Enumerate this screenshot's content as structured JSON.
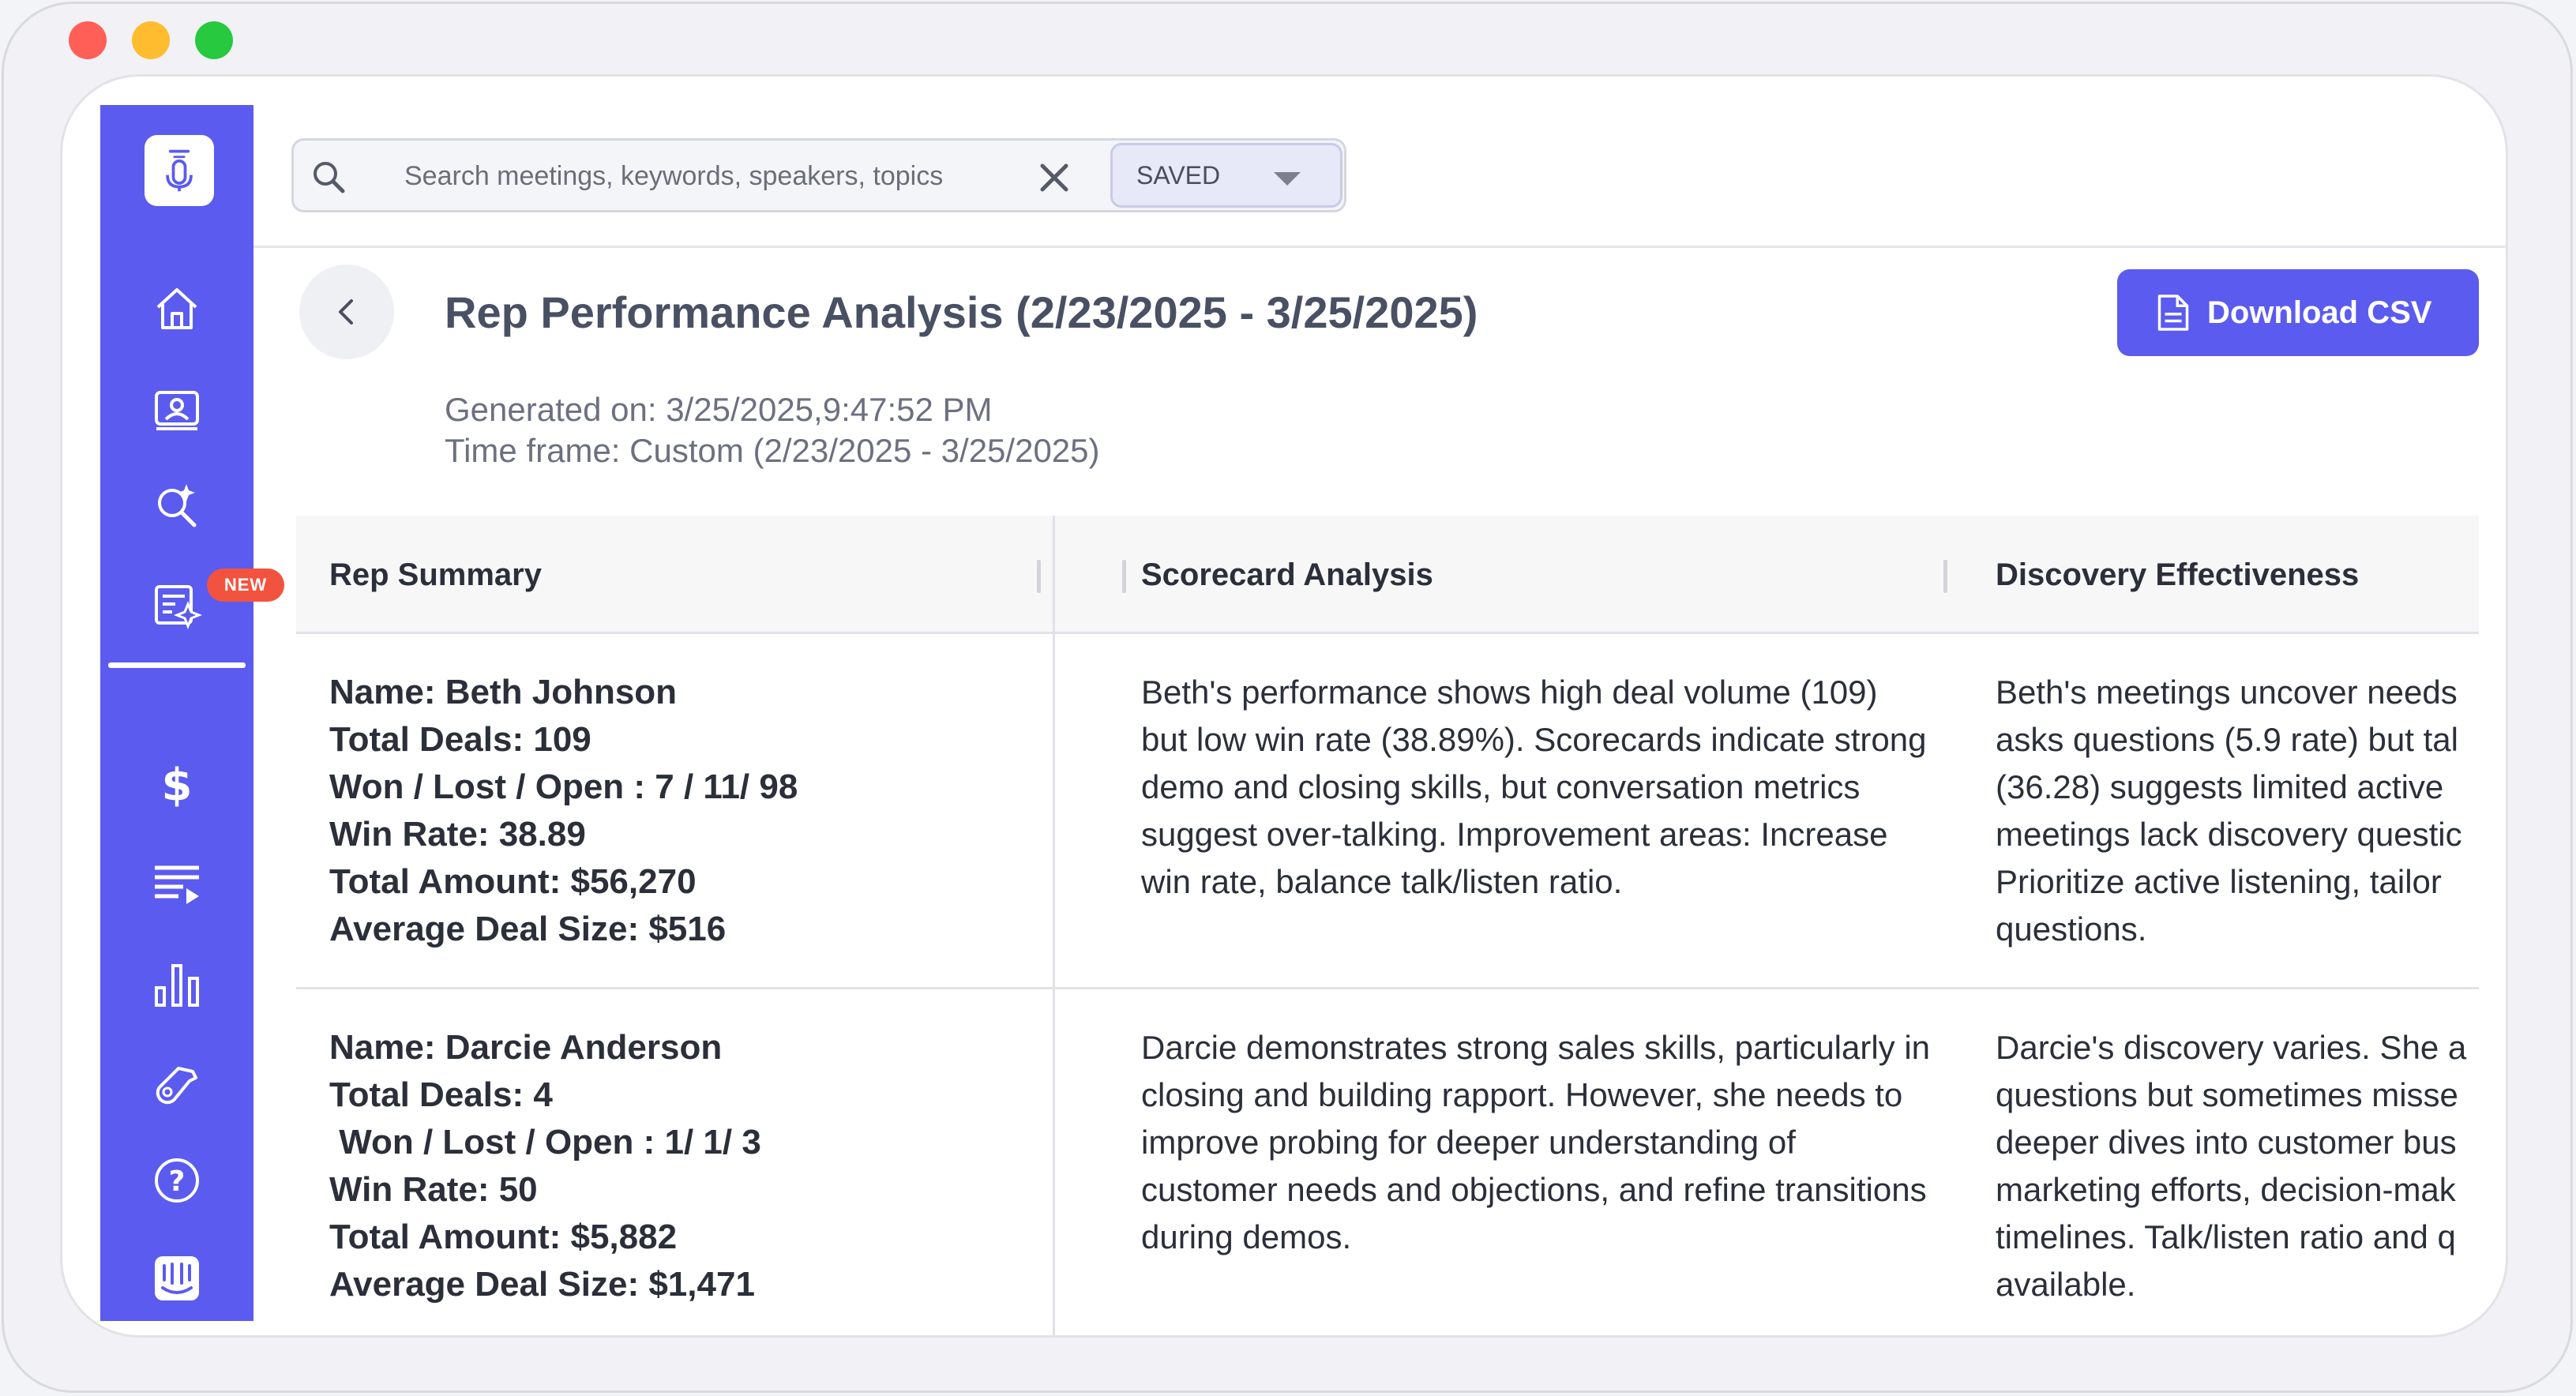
{
  "window": {
    "controls": [
      "close",
      "minimize",
      "maximize"
    ]
  },
  "colors": {
    "brand": "#5b5bf0",
    "badge": "#f2533f"
  },
  "sidebar": {
    "items": [
      {
        "icon": "home-icon"
      },
      {
        "icon": "contact-card-icon"
      },
      {
        "icon": "ai-search-icon"
      },
      {
        "icon": "reports-icon",
        "active": true
      },
      {
        "icon": "dollar-icon"
      },
      {
        "icon": "playlist-icon"
      },
      {
        "icon": "bar-chart-icon"
      },
      {
        "icon": "whistle-icon"
      },
      {
        "icon": "help-icon"
      },
      {
        "icon": "intercom-icon"
      }
    ],
    "new_badge": "NEW"
  },
  "search": {
    "placeholder": "Search meetings, keywords, speakers, topics",
    "saved_label": "SAVED"
  },
  "header": {
    "title": "Rep Performance Analysis (2/23/2025 - 3/25/2025)",
    "generated_on": "Generated on: 3/25/2025,9:47:52 PM",
    "time_frame": "Time frame: Custom (2/23/2025 - 3/25/2025)",
    "download_label": "Download CSV"
  },
  "table": {
    "columns": [
      "Rep Summary",
      "Scorecard Analysis",
      "Discovery Effectiveness"
    ],
    "rows": [
      {
        "rep": "Name: Beth Johnson\nTotal Deals: 109\nWon / Lost / Open : 7 / 11/ 98\nWin Rate: 38.89\nTotal Amount: $56,270\nAverage Deal Size: $516",
        "scorecard": "Beth's performance shows high deal volume (109) but low win rate (38.89%). Scorecards indicate strong demo and closing skills, but conversation metrics suggest over-talking. Improvement areas: Increase win rate, balance talk/listen ratio.",
        "discovery_lines": [
          "Beth's meetings uncover needs",
          "asks questions (5.9 rate) but tal",
          "(36.28) suggests limited active",
          "meetings lack discovery questic",
          "Prioritize active listening, tailor",
          "questions."
        ]
      },
      {
        "rep": "Name: Darcie Anderson\nTotal Deals: 4\n Won / Lost / Open : 1/ 1/ 3\nWin Rate: 50\nTotal Amount: $5,882\nAverage Deal Size: $1,471",
        "scorecard": "Darcie demonstrates strong sales skills, particularly in closing and building rapport. However, she needs to improve probing for deeper understanding of customer needs and objections, and refine transitions during demos.",
        "discovery_lines": [
          "Darcie's discovery varies. She a",
          "questions but sometimes misse",
          "deeper dives into customer bus",
          "marketing efforts, decision-mak",
          "timelines. Talk/listen ratio and q",
          "available."
        ]
      }
    ]
  }
}
